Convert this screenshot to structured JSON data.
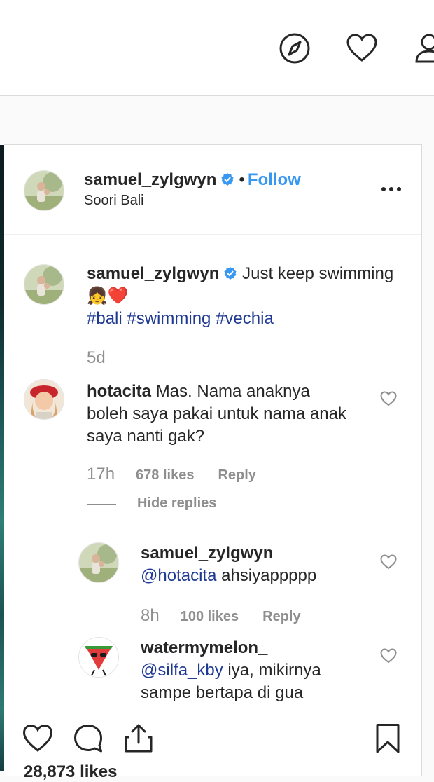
{
  "nav": {
    "icons": [
      "compass-icon",
      "heart-icon",
      "user-icon"
    ]
  },
  "post": {
    "author": "samuel_zylgwyn",
    "follow_label": "Follow",
    "location": "Soori Bali",
    "caption": {
      "author": "samuel_zylgwyn",
      "text": "Just keep swimming",
      "emoji": "👧❤️",
      "hashtags": "#bali #swimming #vechia",
      "time": "5d"
    },
    "comments": [
      {
        "user": "hotacita",
        "line1": "Mas. Nama anaknya",
        "line2": "boleh saya pakai untuk nama anak",
        "line3": "saya nanti gak?",
        "time": "17h",
        "likes": "678 likes",
        "reply": "Reply",
        "hide_replies": "Hide replies"
      }
    ],
    "replies": [
      {
        "user": "samuel_zylgwyn",
        "mention": "@hotacita",
        "text": "ahsiyappppp",
        "time": "8h",
        "likes": "100 likes",
        "reply": "Reply"
      },
      {
        "user": "watermymelon_",
        "mention": "@silfa_kby",
        "text": "iya, mikirnya",
        "line2": "sampe bertapa di gua"
      }
    ],
    "likes_total": "28,873 likes"
  },
  "colors": {
    "link": "#3897f0",
    "hashtag": "#1f3a93",
    "muted": "#8e8e8e",
    "verified": "#3897f0"
  }
}
